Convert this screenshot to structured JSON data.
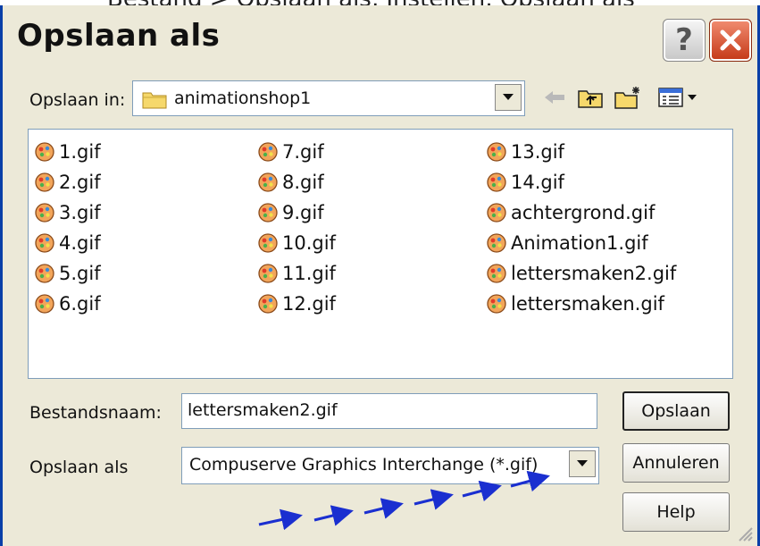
{
  "background_text": "Bestand > Opslaan als, Instellen, Opslaan als",
  "window": {
    "title": "Opslaan als",
    "help_symbol": "?"
  },
  "save_in": {
    "label": "Opslaan in:",
    "folder": "animationshop1"
  },
  "toolbar": {
    "icons": [
      "back-arrow-icon",
      "up-folder-icon",
      "new-folder-icon",
      "view-menu-icon"
    ]
  },
  "files": {
    "columns": [
      [
        "1.gif",
        "2.gif",
        "3.gif",
        "4.gif",
        "5.gif",
        "6.gif"
      ],
      [
        "7.gif",
        "8.gif",
        "9.gif",
        "10.gif",
        "11.gif",
        "12.gif"
      ],
      [
        "13.gif",
        "14.gif",
        "achtergrond.gif",
        "Animation1.gif",
        "lettersmaken2.gif",
        "lettersmaken.gif"
      ]
    ]
  },
  "filename": {
    "label": "Bestandsnaam:",
    "value": "lettersmaken2.gif"
  },
  "filetype": {
    "label": "Opslaan als",
    "value": "Compuserve Graphics Interchange (*.gif)"
  },
  "buttons": {
    "save": "Opslaan",
    "cancel": "Annuleren",
    "help": "Help"
  },
  "colors": {
    "dialog_bg": "#ece9d8",
    "titlebar_edge": "#0a3fa8",
    "annotation_arrows": "#1a2fd0",
    "close_red": "#d5492a"
  }
}
